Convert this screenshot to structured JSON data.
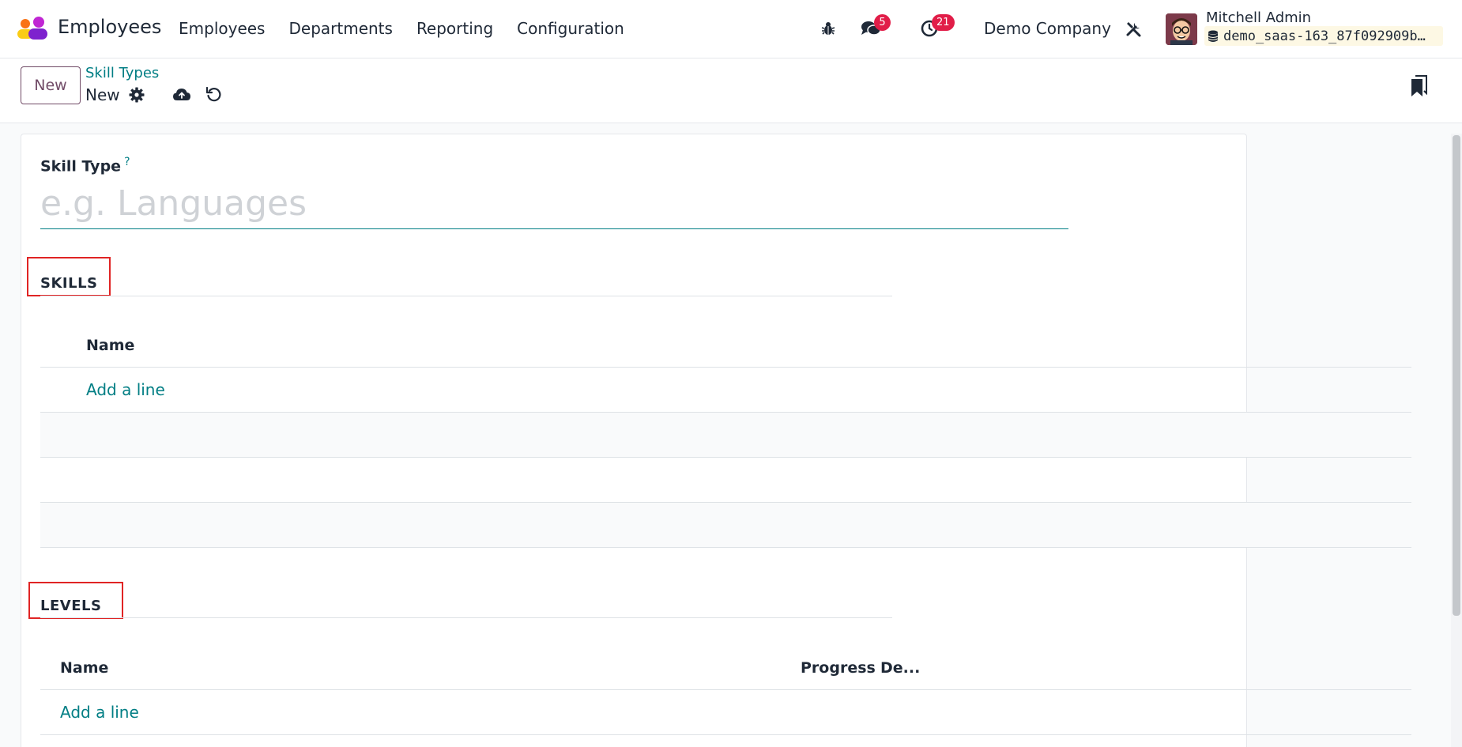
{
  "navbar": {
    "app_name": "Employees",
    "menu": [
      "Employees",
      "Departments",
      "Reporting",
      "Configuration"
    ],
    "messages_count": "5",
    "activities_count": "21",
    "company": "Demo Company",
    "user_name": "Mitchell Admin",
    "database": "demo_saas-163_87f092909b…",
    "icons": [
      "debug-bug-icon",
      "chat-icon",
      "clock-icon",
      "tools-icon",
      "database-icon"
    ]
  },
  "control_panel": {
    "new_button": "New",
    "breadcrumb_parent": "Skill Types",
    "record_name": "New",
    "icons": [
      "gear-icon",
      "cloud-upload-icon",
      "undo-icon",
      "bookmark-icon"
    ]
  },
  "form": {
    "skill_type_label": "Skill Type",
    "help_mark": "?",
    "skill_type_placeholder": "e.g. Languages",
    "skills": {
      "title": "SKILLS",
      "columns": [
        "Name"
      ],
      "add_line": "Add a line"
    },
    "levels": {
      "title": "LEVELS",
      "columns": [
        "Name",
        "Progress",
        "De..."
      ],
      "add_line": "Add a line"
    }
  },
  "colors": {
    "brand": "#714b67",
    "link": "#017e84",
    "badge": "#e11d48",
    "highlight": "#e02424"
  }
}
